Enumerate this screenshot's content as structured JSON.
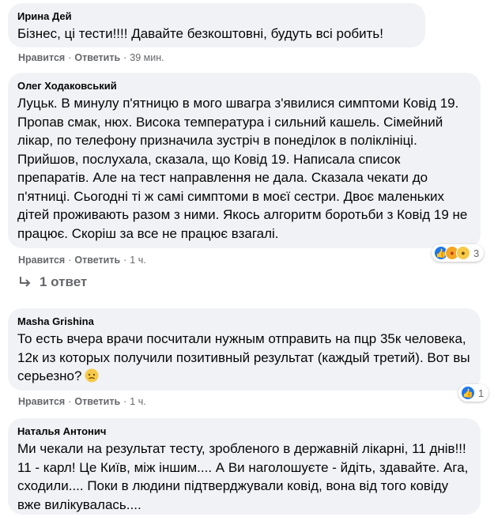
{
  "comments": [
    {
      "author": "Ирина Дей",
      "text": "Бізнес, ці тести!!!! Давайте безкоштовні, будуть всі робить!",
      "like": "Нравится",
      "reply": "Ответить",
      "time": "39 мин."
    },
    {
      "author": "Олег Ходаковський",
      "text": "Луцьк. В минулу п'ятницю в мого швагра з'явилися симптоми Ковід 19. Пропав смак, нюх. Висока температура і сильний кашель. Сімейний лікар, по телефону призначила зустріч в понеділок в поліклініці. Прийшов, послухала, сказала, що Ковід 19. Написала список препаратів. Але на тест направлення не дала. Сказала чекати до п'ятниці. Сьогодні ті ж самі симптоми в моєї сестри. Двоє маленьких дітей проживають разом з ними. Якось алгоритм боротьби з Ковід 19 не працює. Скоріш за все не працює взагалі.",
      "like": "Нравится",
      "reply": "Ответить",
      "time": "1 ч.",
      "reactions": {
        "count": "3",
        "icons": [
          "like-icon",
          "angry-icon",
          "sad-icon"
        ]
      },
      "replies_label": "1 ответ"
    },
    {
      "author": "Masha Grishina",
      "text": "То есть вчера врачи посчитали нужным отправить на пцр 35к человека, 12к из которых получили позитивный результат (каждый третий). Вот вы серьезно?",
      "like": "Нравится",
      "reply": "Ответить",
      "time": "1 ч.",
      "reactions": {
        "count": "1",
        "icons": [
          "like-icon"
        ]
      }
    },
    {
      "author": "Наталья Антонич",
      "text": "Ми чекали на результат тесту, зробленого в державній лікарні, 11 днів!!! 11 - карл! Це Київ, між іншим.... А Ви наголошуєте - йдіть, здавайте. Ага, сходили.... Поки в людини підтверджували ковід, вона від того ковіду вже вилікувалась...."
    }
  ],
  "colors": {
    "bubble": "#f0f2f5",
    "meta": "#65676b",
    "like": "#1877f2"
  }
}
